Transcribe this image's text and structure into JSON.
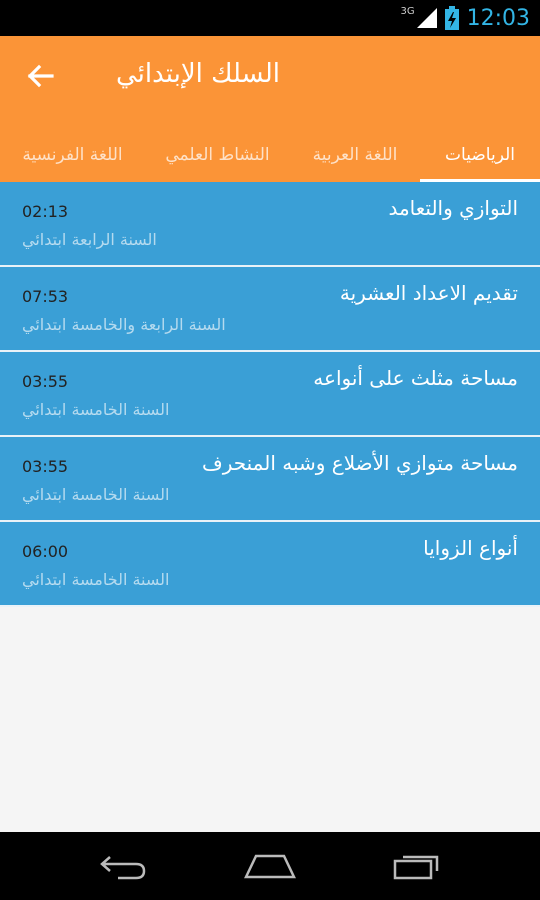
{
  "status_bar": {
    "network": "3G",
    "time": "12:03"
  },
  "app_bar": {
    "title": "السلك الإبتدائي",
    "back_icon": "arrow-left-icon"
  },
  "tabs": [
    {
      "label": "الرياضيات",
      "active": true
    },
    {
      "label": "اللغة العربية",
      "active": false
    },
    {
      "label": "النشاط العلمي",
      "active": false
    },
    {
      "label": "اللغة الفرنسية",
      "active": false
    }
  ],
  "lessons": [
    {
      "title": "التوازي والتعامد",
      "subtitle": "السنة الرابعة ابتدائي",
      "duration": "02:13"
    },
    {
      "title": "تقديم الاعداد العشرية",
      "subtitle": "السنة الرابعة والخامسة ابتدائي",
      "duration": "07:53"
    },
    {
      "title": "مساحة مثلث على أنواعه",
      "subtitle": "السنة الخامسة ابتدائي",
      "duration": "03:55"
    },
    {
      "title": "مساحة متوازي الأضلاع وشبه المنحرف",
      "subtitle": "السنة الخامسة ابتدائي",
      "duration": "03:55"
    },
    {
      "title": "أنواع الزوايا",
      "subtitle": "السنة الخامسة ابتدائي",
      "duration": "06:00"
    }
  ],
  "colors": {
    "app_bar": "#fb9437",
    "list_item": "#3a9fd6",
    "status_accent": "#33b5e5"
  },
  "nav_bar": {
    "back_icon": "nav-back-icon",
    "home_icon": "nav-home-icon",
    "recents_icon": "nav-recents-icon"
  }
}
